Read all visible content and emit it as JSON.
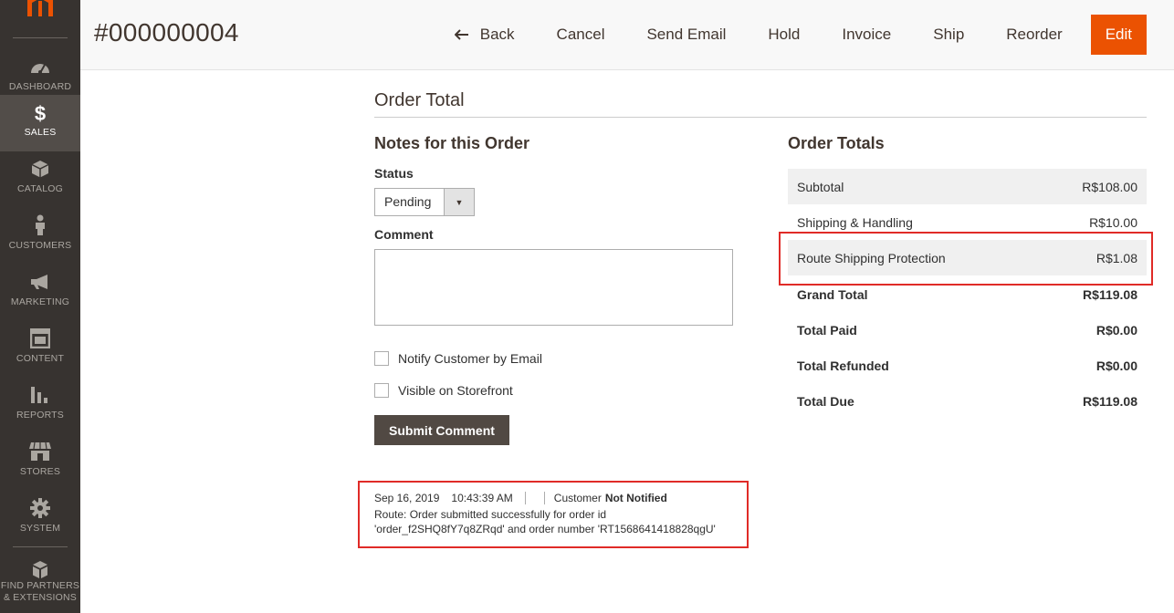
{
  "sidebar": {
    "items": [
      {
        "label": "DASHBOARD",
        "icon": "dashboard-icon"
      },
      {
        "label": "SALES",
        "icon": "dollar-icon",
        "active": true
      },
      {
        "label": "CATALOG",
        "icon": "cube-icon"
      },
      {
        "label": "CUSTOMERS",
        "icon": "person-icon"
      },
      {
        "label": "MARKETING",
        "icon": "megaphone-icon"
      },
      {
        "label": "CONTENT",
        "icon": "layout-icon"
      },
      {
        "label": "REPORTS",
        "icon": "bar-chart-icon"
      },
      {
        "label": "STORES",
        "icon": "storefront-icon"
      },
      {
        "label": "SYSTEM",
        "icon": "gear-icon"
      },
      {
        "label_line1": "FIND PARTNERS",
        "label_line2": "& EXTENSIONS",
        "icon": "boxes-icon"
      }
    ]
  },
  "header": {
    "title": "#000000004",
    "actions": {
      "back": "Back",
      "cancel": "Cancel",
      "send_email": "Send Email",
      "hold": "Hold",
      "invoice": "Invoice",
      "ship": "Ship",
      "reorder": "Reorder",
      "edit": "Edit"
    }
  },
  "section": {
    "title": "Order Total"
  },
  "notes": {
    "title": "Notes for this Order",
    "status_label": "Status",
    "status_value": "Pending",
    "comment_label": "Comment",
    "comment_value": "",
    "notify_label": "Notify Customer by Email",
    "visible_label": "Visible on Storefront",
    "submit_label": "Submit Comment"
  },
  "history": {
    "date": "Sep 16, 2019",
    "time": "10:43:39 AM",
    "customer_label": "Customer",
    "customer_status": "Not Notified",
    "message_line1": "Route: Order submitted successfully for order id",
    "message_line2": "'order_f2SHQ8fY7q8ZRqd' and order number 'RT1568641418828qgU'"
  },
  "totals": {
    "title": "Order Totals",
    "rows": [
      {
        "label": "Subtotal",
        "value": "R$108.00"
      },
      {
        "label": "Shipping & Handling",
        "value": "R$10.00"
      },
      {
        "label": "Route Shipping Protection",
        "value": "R$1.08"
      },
      {
        "label": "Grand Total",
        "value": "R$119.08"
      },
      {
        "label": "Total Paid",
        "value": "R$0.00"
      },
      {
        "label": "Total Refunded",
        "value": "R$0.00"
      },
      {
        "label": "Total Due",
        "value": "R$119.08"
      }
    ]
  },
  "colors": {
    "sidebar_bg": "#373330",
    "sidebar_active": "#524d49",
    "accent": "#eb5202",
    "highlight_border": "#e02b27",
    "submit_bg": "#514943"
  }
}
